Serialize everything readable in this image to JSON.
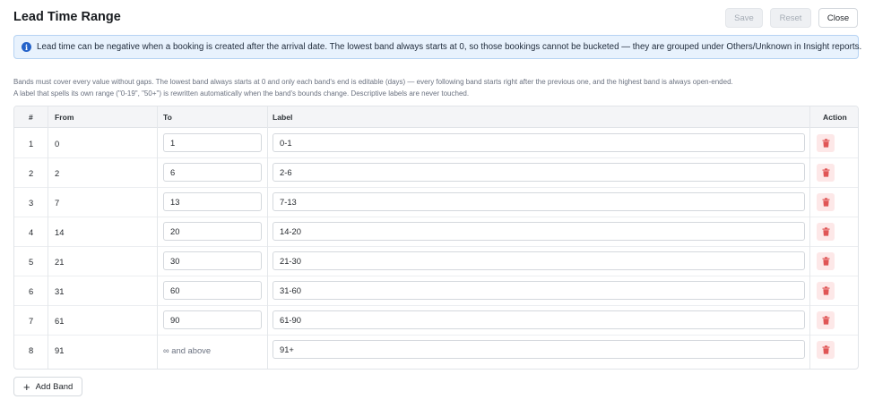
{
  "header": {
    "title": "Lead Time Range",
    "save_label": "Save",
    "reset_label": "Reset",
    "close_label": "Close"
  },
  "info": {
    "text": "Lead time can be negative when a booking is created after the arrival date. The lowest band always starts at 0, so those bookings cannot be bucketed — they are grouped under Others/Unknown in Insight reports."
  },
  "help": {
    "line1": "Bands must cover every value without gaps. The lowest band always starts at 0 and only each band's end is editable (days) — every following band starts right after the previous one, and the highest band is always open-ended.",
    "line2": "A label that spells its own range (\"0-19\", \"50+\") is rewritten automatically when the band's bounds change. Descriptive labels are never touched."
  },
  "table": {
    "columns": {
      "num": "#",
      "from": "From",
      "to": "To",
      "label": "Label",
      "action": "Action"
    },
    "rows": [
      {
        "num": "1",
        "from": "0",
        "to": "1",
        "label": "0-1"
      },
      {
        "num": "2",
        "from": "2",
        "to": "6",
        "label": "2-6"
      },
      {
        "num": "3",
        "from": "7",
        "to": "13",
        "label": "7-13"
      },
      {
        "num": "4",
        "from": "14",
        "to": "20",
        "label": "14-20"
      },
      {
        "num": "5",
        "from": "21",
        "to": "30",
        "label": "21-30"
      },
      {
        "num": "6",
        "from": "31",
        "to": "60",
        "label": "31-60"
      },
      {
        "num": "7",
        "from": "61",
        "to": "90",
        "label": "61-90"
      },
      {
        "num": "8",
        "from": "91",
        "to_text": "∞ and above",
        "label": "91+"
      }
    ]
  },
  "footer": {
    "add_label": "Add Band"
  },
  "colors": {
    "accent": "#2563c9",
    "danger": "#e05555",
    "info_bg": "#e8f2fd"
  }
}
